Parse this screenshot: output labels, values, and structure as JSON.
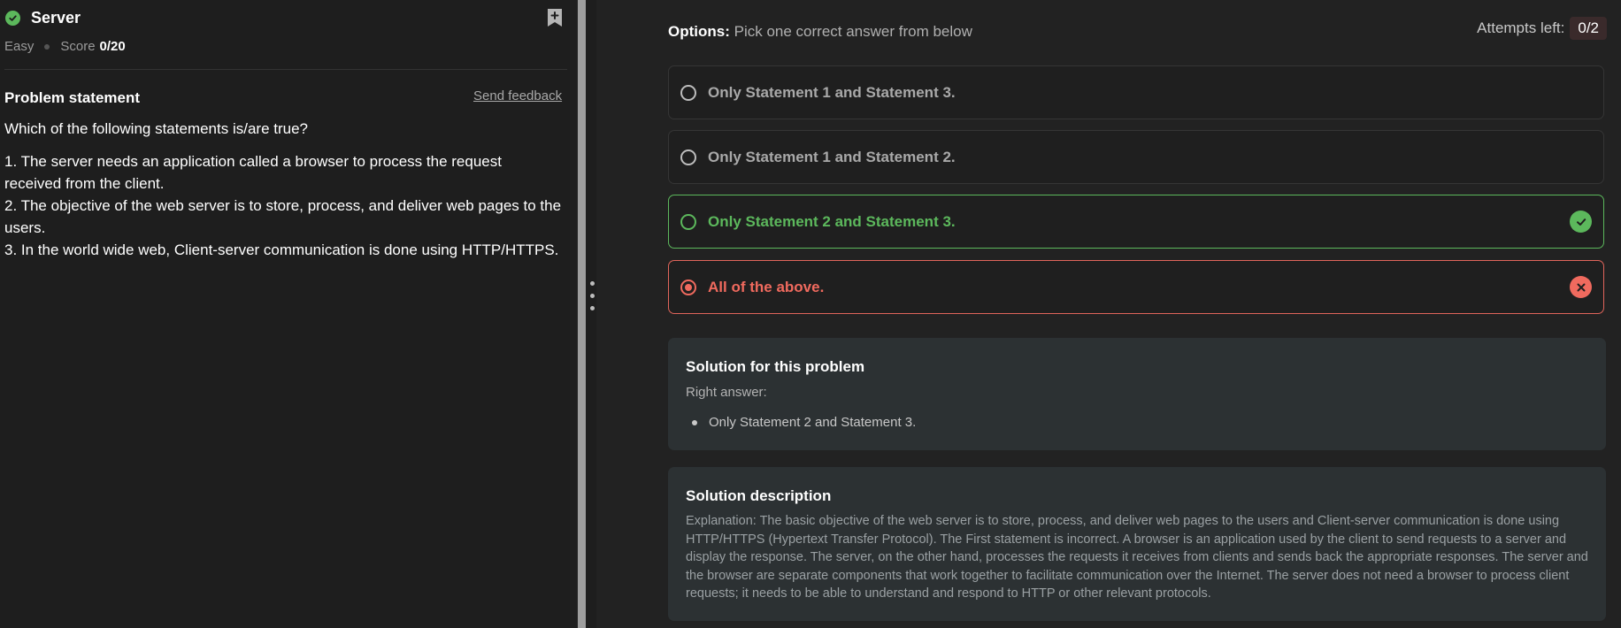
{
  "problem": {
    "title": "Server",
    "difficulty": "Easy",
    "score_label": "Score",
    "score_value": "0/20",
    "section_title": "Problem statement",
    "feedback_link": "Send feedback",
    "question": "Which of the following statements is/are true?",
    "statements": [
      "1. The server needs an application called a browser to process the request received from the client.",
      "2. The objective of the web server is to store, process, and deliver web pages to the users.",
      "3. In the world wide web, Client-server communication is done using HTTP/HTTPS."
    ]
  },
  "options_panel": {
    "header_label": "Options:",
    "header_hint": "Pick one correct answer from below",
    "attempts_label": "Attempts left:",
    "attempts_value": "0/2",
    "options": [
      {
        "label": "Only Statement 1 and Statement 3.",
        "state": "default"
      },
      {
        "label": "Only Statement 1 and Statement 2.",
        "state": "default"
      },
      {
        "label": "Only Statement 2 and Statement 3.",
        "state": "correct"
      },
      {
        "label": "All of the above.",
        "state": "wrong-selected"
      }
    ]
  },
  "solution": {
    "title": "Solution for this problem",
    "right_answer_label": "Right answer:",
    "right_answer": "Only Statement 2 and Statement 3."
  },
  "description": {
    "title": "Solution description",
    "text": "Explanation: The basic objective of the web server is to store, process, and deliver web pages to the users and Client-server communication is done using HTTP/HTTPS (Hypertext Transfer Protocol). The First statement is incorrect. A browser is an application used by the client to send requests to a server and display the response. The server, on the other hand, processes the requests it receives from clients and sends back the appropriate responses. The server and the browser are separate components that work together to facilitate communication over the Internet. The server does not need a browser to process client requests; it needs to be able to understand and respond to HTTP or other relevant protocols."
  },
  "colors": {
    "correct": "#5cb85c",
    "wrong": "#f06a5e",
    "card_bg": "#2c3133"
  },
  "icons": {
    "status": "check-circle-icon",
    "bookmark": "bookmark-add-icon",
    "correct": "check-icon",
    "wrong": "x-icon"
  }
}
